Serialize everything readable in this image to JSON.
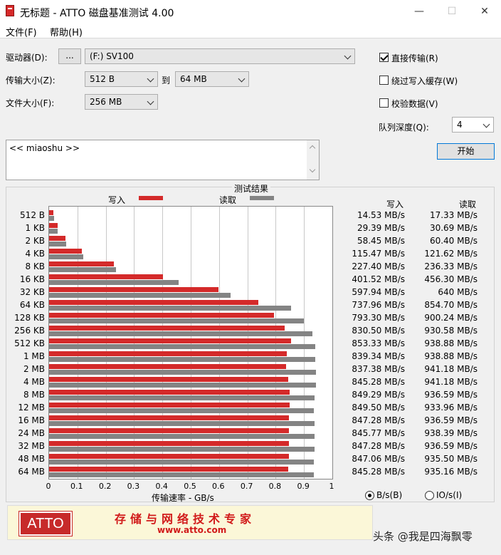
{
  "window": {
    "title": "无标题 - ATTO 磁盘基准测试 4.00",
    "minimize": "—",
    "maximize": "☐",
    "close": "✕"
  },
  "menu": {
    "file": "文件(F)",
    "help": "帮助(H)"
  },
  "settings": {
    "drive_label": "驱动器(D):",
    "browse_label": "...",
    "drive_value": "(F:) SV100",
    "transfer_label": "传输大小(Z):",
    "transfer_from": "512 B",
    "to_label": "到",
    "transfer_to": "64 MB",
    "file_size_label": "文件大小(F):",
    "file_size_value": "256 MB",
    "direct_io_label": "直接传输(R)",
    "direct_io_checked": true,
    "bypass_cache_label": "绕过写入缓存(W)",
    "bypass_cache_checked": false,
    "verify_label": "校验数据(V)",
    "verify_checked": false,
    "queue_label": "队列深度(Q):",
    "queue_value": "4",
    "start_label": "开始",
    "description": "<< miaoshu >>"
  },
  "results": {
    "title": "测试结果",
    "legend_write": "写入",
    "legend_read": "读取",
    "col_write": "写入",
    "col_read": "读取",
    "xlabel": "传输速率 - GB/s",
    "unit_bs": "B/s(B)",
    "unit_ios": "IO/s(I)",
    "unit_bs_selected": true,
    "write_color": "#d42a2a",
    "read_color": "#848484"
  },
  "chart_data": {
    "type": "bar",
    "orientation": "horizontal",
    "title": "测试结果",
    "xlabel": "传输速率 - GB/s",
    "xlim": [
      0,
      1
    ],
    "xticks": [
      "0",
      "0.1",
      "0.2",
      "0.3",
      "0.4",
      "0.5",
      "0.6",
      "0.7",
      "0.8",
      "0.9",
      "1"
    ],
    "grid": true,
    "legend": "top",
    "categories": [
      "512 B",
      "1 KB",
      "2 KB",
      "4 KB",
      "8 KB",
      "16 KB",
      "32 KB",
      "64 KB",
      "128 KB",
      "256 KB",
      "512 KB",
      "1 MB",
      "2 MB",
      "4 MB",
      "8 MB",
      "12 MB",
      "16 MB",
      "24 MB",
      "32 MB",
      "48 MB",
      "64 MB"
    ],
    "series": [
      {
        "name": "写入",
        "values": [
          0.0145,
          0.0294,
          0.0585,
          0.1155,
          0.2274,
          0.4015,
          0.5979,
          0.738,
          0.7933,
          0.8305,
          0.8533,
          0.8393,
          0.8374,
          0.8453,
          0.8493,
          0.8495,
          0.8473,
          0.8458,
          0.8473,
          0.8471,
          0.8453
        ]
      },
      {
        "name": "读取",
        "values": [
          0.0173,
          0.0307,
          0.0604,
          0.1216,
          0.2363,
          0.4563,
          0.64,
          0.8547,
          0.9002,
          0.9306,
          0.9389,
          0.9389,
          0.9412,
          0.9412,
          0.9366,
          0.934,
          0.9366,
          0.9384,
          0.9366,
          0.9355,
          0.9352
        ]
      }
    ],
    "write_labels": [
      "14.53 MB/s",
      "29.39 MB/s",
      "58.45 MB/s",
      "115.47 MB/s",
      "227.40 MB/s",
      "401.52 MB/s",
      "597.94 MB/s",
      "737.96 MB/s",
      "793.30 MB/s",
      "830.50 MB/s",
      "853.33 MB/s",
      "839.34 MB/s",
      "837.38 MB/s",
      "845.28 MB/s",
      "849.29 MB/s",
      "849.50 MB/s",
      "847.28 MB/s",
      "845.77 MB/s",
      "847.28 MB/s",
      "847.06 MB/s",
      "845.28 MB/s"
    ],
    "read_labels": [
      "17.33 MB/s",
      "30.69 MB/s",
      "60.40 MB/s",
      "121.62 MB/s",
      "236.33 MB/s",
      "456.30 MB/s",
      "640 MB/s",
      "854.70 MB/s",
      "900.24 MB/s",
      "930.58 MB/s",
      "938.88 MB/s",
      "938.88 MB/s",
      "941.18 MB/s",
      "941.18 MB/s",
      "936.59 MB/s",
      "933.96 MB/s",
      "936.59 MB/s",
      "938.39 MB/s",
      "936.59 MB/s",
      "935.50 MB/s",
      "935.16 MB/s"
    ]
  },
  "banner": {
    "logo": "ATTO",
    "slogan": "存储与网络技术专家",
    "url": "www.atto.com"
  },
  "watermark": "头条 @我是四海飘零"
}
